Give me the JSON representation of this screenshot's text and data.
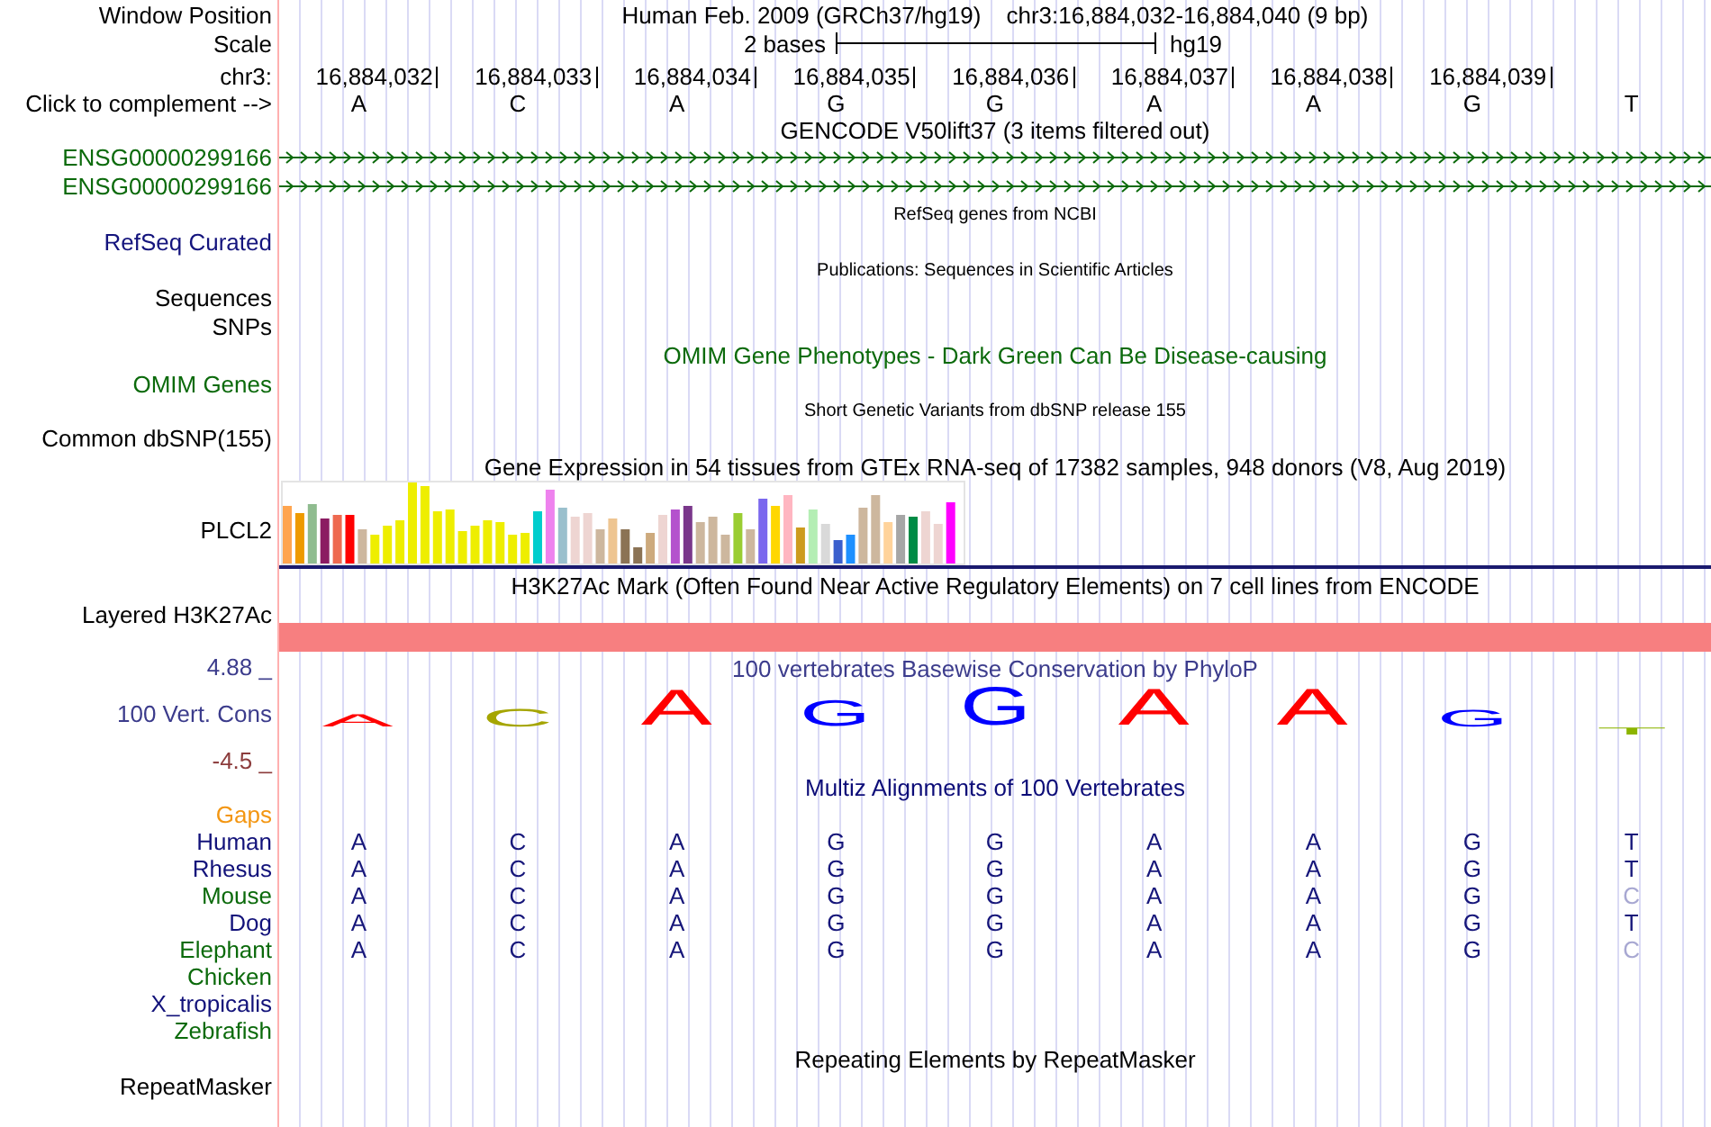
{
  "position": {
    "label": "Window Position",
    "assembly": "Human Feb. 2009 (GRCh37/hg19)",
    "range": "chr3:16,884,032-16,884,040 (9 bp)"
  },
  "scale": {
    "label": "Scale",
    "span": "2 bases",
    "assembly": "hg19"
  },
  "ruler": {
    "label": "chr3:",
    "positions": [
      "16,884,032",
      "16,884,033",
      "16,884,034",
      "16,884,035",
      "16,884,036",
      "16,884,037",
      "16,884,038",
      "16,884,039"
    ]
  },
  "sequence": {
    "label": "Click to complement -->",
    "bases": [
      "A",
      "C",
      "A",
      "G",
      "G",
      "A",
      "A",
      "G",
      "T"
    ]
  },
  "gencode": {
    "title": "GENCODE V50lift37 (3 items filtered out)",
    "genes": [
      {
        "label": "ENSG00000299166"
      },
      {
        "label": "ENSG00000299166"
      }
    ]
  },
  "refseq": {
    "title": "RefSeq genes from NCBI",
    "label": "RefSeq Curated"
  },
  "publications": {
    "title": "Publications: Sequences in Scientific Articles",
    "subtracks": [
      {
        "label": "Sequences"
      },
      {
        "label": "SNPs"
      }
    ]
  },
  "omim": {
    "title": "OMIM Gene Phenotypes - Dark Green Can Be Disease-causing",
    "label": "OMIM Genes"
  },
  "dbsnp": {
    "title": "Short Genetic Variants from dbSNP release 155",
    "label": "Common dbSNP(155)"
  },
  "gtex": {
    "title": "Gene Expression in 54 tissues from GTEx RNA-seq of 17382 samples, 948 donors (V8, Aug 2019)",
    "label": "PLCL2"
  },
  "h3k27ac": {
    "title": "H3K27Ac Mark (Often Found Near Active Regulatory Elements) on 7 cell lines from ENCODE",
    "label": "Layered H3K27Ac"
  },
  "phylop": {
    "title": "100 vertebrates Basewise Conservation by PhyloP",
    "label": "100 Vert. Cons",
    "max_label": "4.88 _",
    "min_label": "-4.5 _",
    "logo": [
      "A",
      "C",
      "A",
      "G",
      "G",
      "A",
      "A",
      "G",
      "T"
    ]
  },
  "multiz": {
    "title": "Multiz Alignments of 100 Vertebrates",
    "rows": [
      {
        "label": "Gaps",
        "color": "#f39612"
      },
      {
        "label": "Human",
        "color": "#12127a",
        "bases": [
          {
            "base": "A",
            "faded": false
          },
          {
            "base": "C",
            "faded": false
          },
          {
            "base": "A",
            "faded": false
          },
          {
            "base": "G",
            "faded": false
          },
          {
            "base": "G",
            "faded": false
          },
          {
            "base": "A",
            "faded": false
          },
          {
            "base": "A",
            "faded": false
          },
          {
            "base": "G",
            "faded": false
          },
          {
            "base": "T",
            "faded": false
          }
        ]
      },
      {
        "label": "Rhesus",
        "color": "#12127a",
        "bases": [
          {
            "base": "A",
            "faded": false
          },
          {
            "base": "C",
            "faded": false
          },
          {
            "base": "A",
            "faded": false
          },
          {
            "base": "G",
            "faded": false
          },
          {
            "base": "G",
            "faded": false
          },
          {
            "base": "A",
            "faded": false
          },
          {
            "base": "A",
            "faded": false
          },
          {
            "base": "G",
            "faded": false
          },
          {
            "base": "T",
            "faded": false
          }
        ]
      },
      {
        "label": "Mouse",
        "color": "#0b6a0b",
        "bases": [
          {
            "base": "A",
            "faded": false
          },
          {
            "base": "C",
            "faded": false
          },
          {
            "base": "A",
            "faded": false
          },
          {
            "base": "G",
            "faded": false
          },
          {
            "base": "G",
            "faded": false
          },
          {
            "base": "A",
            "faded": false
          },
          {
            "base": "A",
            "faded": false
          },
          {
            "base": "G",
            "faded": false
          },
          {
            "base": "C",
            "faded": true
          }
        ]
      },
      {
        "label": "Dog",
        "color": "#12127a",
        "bases": [
          {
            "base": "A",
            "faded": false
          },
          {
            "base": "C",
            "faded": false
          },
          {
            "base": "A",
            "faded": false
          },
          {
            "base": "G",
            "faded": false
          },
          {
            "base": "G",
            "faded": false
          },
          {
            "base": "A",
            "faded": false
          },
          {
            "base": "A",
            "faded": false
          },
          {
            "base": "G",
            "faded": false
          },
          {
            "base": "T",
            "faded": false
          }
        ]
      },
      {
        "label": "Elephant",
        "color": "#0b6a0b",
        "bases": [
          {
            "base": "A",
            "faded": false
          },
          {
            "base": "C",
            "faded": false
          },
          {
            "base": "A",
            "faded": false
          },
          {
            "base": "G",
            "faded": false
          },
          {
            "base": "G",
            "faded": false
          },
          {
            "base": "A",
            "faded": false
          },
          {
            "base": "A",
            "faded": false
          },
          {
            "base": "G",
            "faded": false
          },
          {
            "base": "C",
            "faded": true
          }
        ]
      },
      {
        "label": "Chicken",
        "color": "#0b6a0b"
      },
      {
        "label": "X_tropicalis",
        "color": "#12127a"
      },
      {
        "label": "Zebrafish",
        "color": "#0b6a0b"
      }
    ]
  },
  "repeatmasker": {
    "title": "Repeating Elements by RepeatMasker",
    "label": "RepeatMasker"
  }
}
